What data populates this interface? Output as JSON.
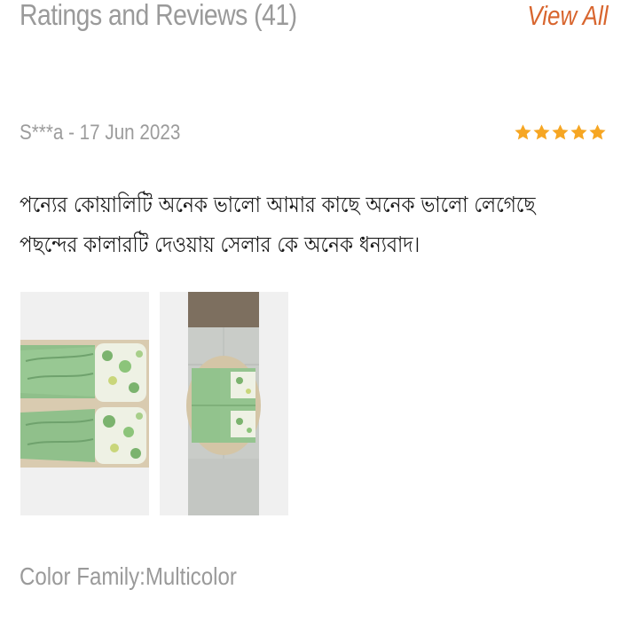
{
  "header": {
    "title": "Ratings and Reviews (41)",
    "view_all_label": "View All"
  },
  "review": {
    "author_date": "S***a - 17 Jun 2023",
    "rating": 5,
    "rating_color": "#f6a623",
    "text_line_1": "পন্যের কোয়ালিটি অনেক ভালো আমার কাছে অনেক ভালো লেগেছে",
    "text_line_2": "পছন্দের কালারটি দেওয়ায় সেলার কে অনেক ধন্যবাদ।",
    "photos": [
      "review-photo-1",
      "review-photo-2"
    ],
    "color_family": "Color Family:Multicolor"
  },
  "colors": {
    "accent": "#d8652e",
    "muted_text": "#9a9a9a",
    "body_text": "#1a1a1a"
  }
}
